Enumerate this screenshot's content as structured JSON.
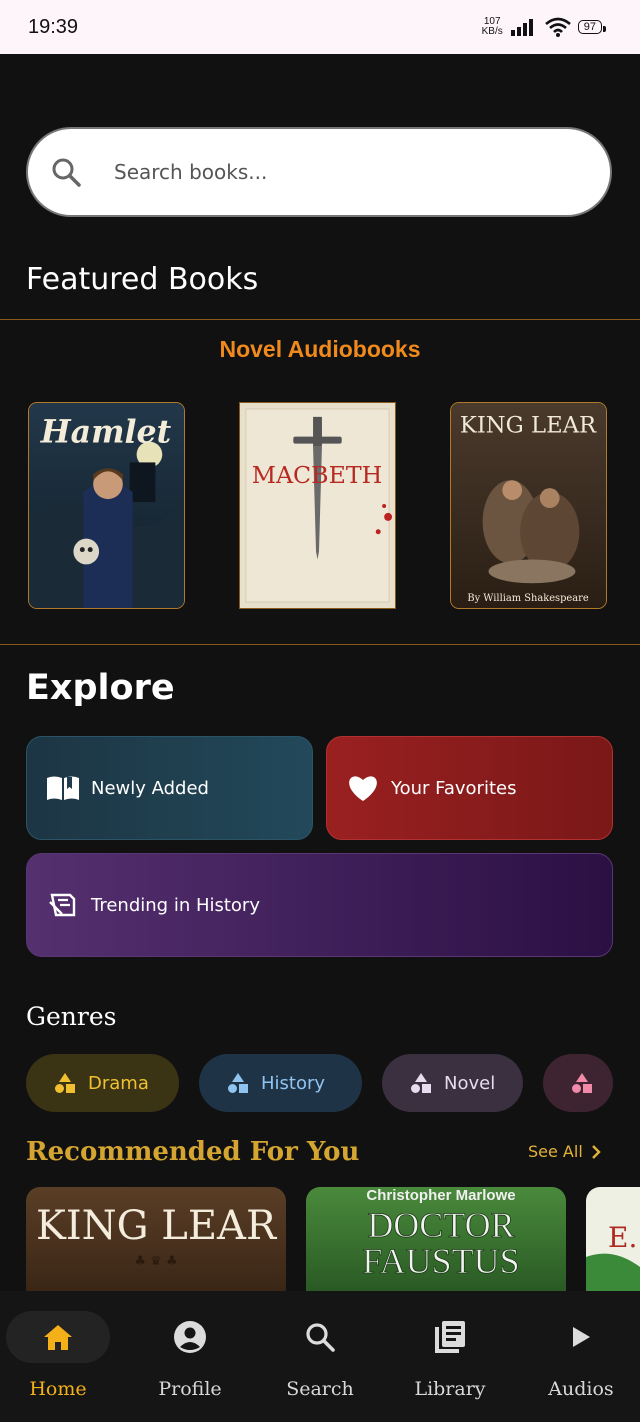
{
  "status_bar": {
    "time": "19:39",
    "net_speed_value": "107",
    "net_speed_unit": "KB/s",
    "battery": "97"
  },
  "search": {
    "placeholder": "Search books..."
  },
  "featured": {
    "title": "Featured Books",
    "section_title": "Novel Audiobooks",
    "books": [
      {
        "title": "Hamlet"
      },
      {
        "title": "MACBETH"
      },
      {
        "title": "KING LEAR",
        "byline": "By William Shakespeare"
      }
    ]
  },
  "explore": {
    "title": "Explore",
    "tiles": [
      {
        "label": "Newly Added",
        "icon": "open-book-icon"
      },
      {
        "label": "Your Favorites",
        "icon": "heart-icon"
      },
      {
        "label": "Trending in History",
        "icon": "history-icon"
      }
    ]
  },
  "genres": {
    "title": "Genres",
    "items": [
      {
        "label": "Drama",
        "color": "#f0c030"
      },
      {
        "label": "History",
        "color": "#8fc4f0"
      },
      {
        "label": "Novel",
        "color": "#e6dcef"
      },
      {
        "label": "",
        "color": "#f08aa8"
      }
    ]
  },
  "recommended": {
    "title": "Recommended For You",
    "see_all": "See All",
    "books": [
      {
        "title": "KING LEAR"
      },
      {
        "author": "Christopher Marlowe",
        "title_line1": "DOCTOR",
        "title_line2": "FAUSTUS"
      },
      {
        "title": "E."
      }
    ]
  },
  "nav": {
    "items": [
      {
        "label": "Home",
        "icon": "home-icon",
        "active": true
      },
      {
        "label": "Profile",
        "icon": "profile-icon"
      },
      {
        "label": "Search",
        "icon": "search-icon"
      },
      {
        "label": "Library",
        "icon": "library-icon"
      },
      {
        "label": "Audios",
        "icon": "play-icon"
      }
    ]
  },
  "colors": {
    "accent": "#f3b019",
    "section_orange": "#f08a1c",
    "background": "#111111"
  }
}
